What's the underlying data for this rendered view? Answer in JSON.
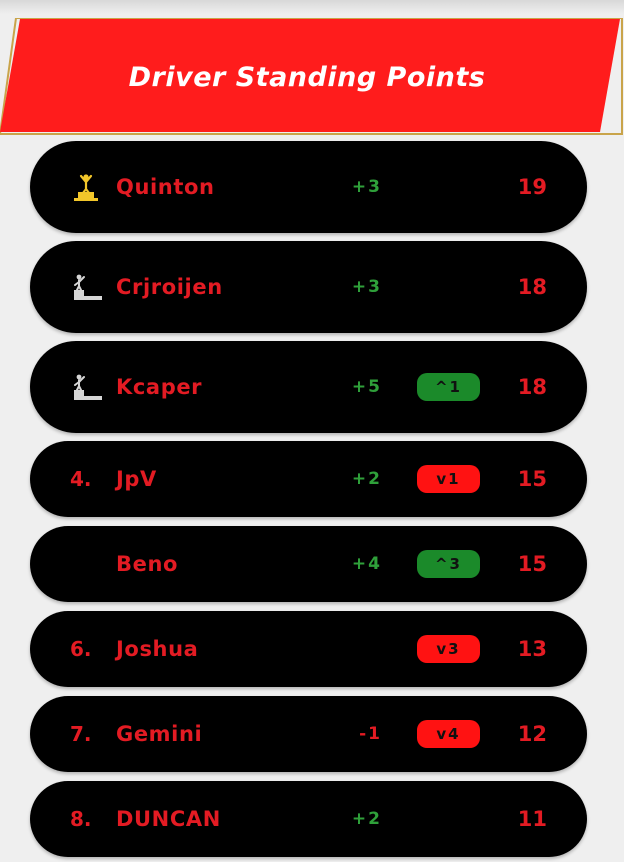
{
  "header": {
    "title": "Driver Standing Points",
    "banner_color": "#ff1c1c",
    "border_color": "#c9a44a"
  },
  "standings": [
    {
      "position": "",
      "podium": "gold",
      "name": "Quinton",
      "gain": "+3",
      "change": "",
      "change_dir": "",
      "points": "19"
    },
    {
      "position": "",
      "podium": "silver",
      "name": "Crjroijen",
      "gain": "+3",
      "change": "",
      "change_dir": "",
      "points": "18"
    },
    {
      "position": "",
      "podium": "silver",
      "name": "Kcaper",
      "gain": "+5",
      "change": "^1",
      "change_dir": "up",
      "points": "18"
    },
    {
      "position": "4.",
      "podium": "",
      "name": "JpV",
      "gain": "+2",
      "change": "v1",
      "change_dir": "down",
      "points": "15"
    },
    {
      "position": "",
      "podium": "",
      "name": "Beno",
      "gain": "+4",
      "change": "^3",
      "change_dir": "up",
      "points": "15"
    },
    {
      "position": "6.",
      "podium": "",
      "name": "Joshua",
      "gain": "",
      "change": "v3",
      "change_dir": "down",
      "points": "13"
    },
    {
      "position": "7.",
      "podium": "",
      "name": "Gemini",
      "gain": "-1",
      "change": "v4",
      "change_dir": "down",
      "points": "12"
    },
    {
      "position": "8.",
      "podium": "",
      "name": "DUNCAN",
      "gain": "+2",
      "change": "",
      "change_dir": "",
      "points": "11"
    }
  ],
  "colors": {
    "text_red": "#e31b23",
    "gain_green": "#2fa03a",
    "badge_up": "#1b8a2a",
    "badge_down": "#ff1212",
    "gold": "#f2c62a",
    "silver": "#d6d6d6"
  }
}
